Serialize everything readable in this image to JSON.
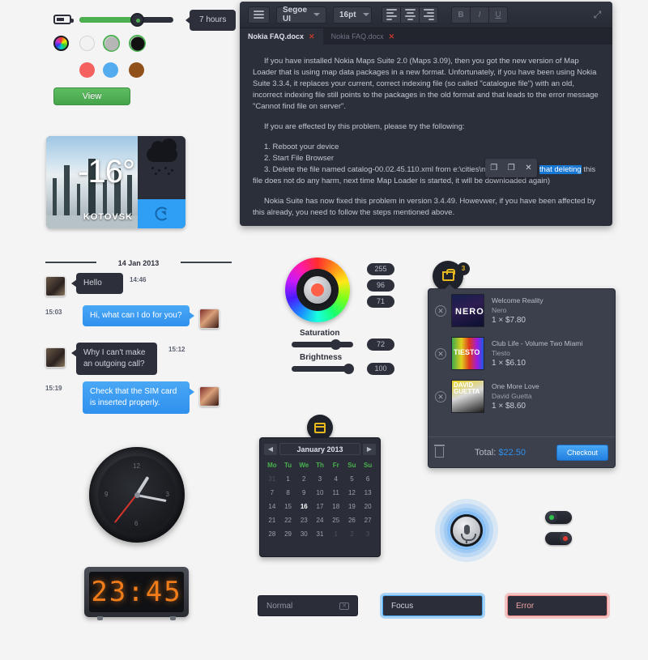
{
  "slider": {
    "tooltip": "7 hours",
    "fill_percent": 58,
    "icon": "battery-icon"
  },
  "swatches": {
    "row1": [
      {
        "name": "rainbow",
        "color": "rainbow",
        "selected": false
      },
      {
        "name": "white",
        "color": "#f2f2f2",
        "selected": false
      },
      {
        "name": "gray",
        "color": "#b6b6b6",
        "selected": true
      },
      {
        "name": "black",
        "color": "#111111",
        "selected": true
      }
    ],
    "row2": [
      {
        "name": "red",
        "color": "#f4615f"
      },
      {
        "name": "blue",
        "color": "#53abf0"
      },
      {
        "name": "brown",
        "color": "#91511a"
      }
    ]
  },
  "view_button": {
    "label": "View"
  },
  "weather": {
    "temperature": "-16°",
    "city": "KOTOVSK",
    "condition_icon": "snow-cloud-icon",
    "refresh_icon": "refresh-icon"
  },
  "chat": {
    "date": "14 Jan 2013",
    "messages": [
      {
        "side": "left",
        "text": "Hello",
        "time": "14:46"
      },
      {
        "side": "right",
        "text": "Hi, what can I do for you?",
        "time": "15:03"
      },
      {
        "side": "left",
        "text": "Why I can't make an outgoing call?",
        "time": "15:12"
      },
      {
        "side": "right",
        "text": "Check that the SIM card is inserted properly.",
        "time": "15:19"
      }
    ]
  },
  "analog_clock": {
    "numerals": [
      "12",
      "3",
      "6",
      "9"
    ]
  },
  "digital_clock": {
    "time": "23:45"
  },
  "editor": {
    "font_family": "Segoe UI",
    "font_size": "16pt",
    "bold_label": "B",
    "italic_label": "I",
    "underline_label": "U",
    "menu_icon": "hamburger-menu-icon",
    "resize_icon": "resize-icon",
    "tabs": [
      {
        "label": "Nokia FAQ.docx",
        "active": true,
        "close": "✕"
      },
      {
        "label": "Nokia FAQ.docx",
        "active": false,
        "close": "✕"
      }
    ],
    "paragraphs": {
      "p1": "If you have installed Nokia Maps Suite 2.0 (Maps 3.09), then you got the new version of Map Loader that is using map data packages in a new format. Unfortunately, if you have been using Nokia Suite 3.3.4, it replaces your current, correct indexing file (so called \"catalogue file\")  with an old, incorrect indexing file still points to the packages in the old format and that leads to the error message \"Cannot find file on server\".",
      "p2": "If you are effected by this problem, please try the following:",
      "step1": "1. Reboot your device",
      "step2": "2. Start File Browser",
      "step3_pre": "3. Delete the file named catalog-00.02.45.110.xml from e:\\cities\\maploader (note ",
      "step3_highlight": "that deleting",
      "step3_post": " this file does not do any harm, next time Map Loader is started, it will be downloaded again)",
      "p4": "Nokia Suite has now fixed this problem in version 3.4.49. Howevwer, if you have been affected by this already, you need to follow the steps mentioned above."
    },
    "float_toolbar": {
      "copy": "copy-icon",
      "paste": "paste-icon",
      "cut": "✕"
    }
  },
  "color_picker": {
    "values": [
      "255",
      "96",
      "71"
    ],
    "saturation": {
      "label": "Saturation",
      "value": "72"
    },
    "brightness": {
      "label": "Brightness",
      "value": "100"
    },
    "selected_color": "#ff6047"
  },
  "calendar": {
    "title": "January 2013",
    "prev": "◀",
    "next": "▶",
    "badge_icon": "calendar-icon",
    "day_names": [
      "Mo",
      "Tu",
      "We",
      "Th",
      "Fr",
      "Su",
      "Su"
    ],
    "weeks": [
      [
        {
          "d": "31",
          "m": true
        },
        {
          "d": "1"
        },
        {
          "d": "2"
        },
        {
          "d": "3"
        },
        {
          "d": "4"
        },
        {
          "d": "5"
        },
        {
          "d": "6"
        }
      ],
      [
        {
          "d": "7"
        },
        {
          "d": "8"
        },
        {
          "d": "9"
        },
        {
          "d": "10"
        },
        {
          "d": "11"
        },
        {
          "d": "12"
        },
        {
          "d": "13"
        }
      ],
      [
        {
          "d": "14"
        },
        {
          "d": "15"
        },
        {
          "d": "16",
          "today": true
        },
        {
          "d": "17"
        },
        {
          "d": "18"
        },
        {
          "d": "19"
        },
        {
          "d": "20"
        }
      ],
      [
        {
          "d": "21"
        },
        {
          "d": "22"
        },
        {
          "d": "23"
        },
        {
          "d": "24"
        },
        {
          "d": "25"
        },
        {
          "d": "26"
        },
        {
          "d": "27"
        }
      ],
      [
        {
          "d": "28"
        },
        {
          "d": "29"
        },
        {
          "d": "30"
        },
        {
          "d": "31"
        },
        {
          "d": "1",
          "m": true
        },
        {
          "d": "2",
          "m": true
        },
        {
          "d": "3",
          "m": true
        }
      ]
    ]
  },
  "cart": {
    "count": "3",
    "cart_icon": "shopping-basket-icon",
    "items": [
      {
        "title": "Welcome Reality",
        "artist": "Nero",
        "price": "1 × $7.80",
        "art": "nero"
      },
      {
        "title": "Club Life - Volume Two Miami",
        "artist": "Tiesto",
        "price": "1 × $6.10",
        "art": "tiesto"
      },
      {
        "title": "One More Love",
        "artist": "David Guetta",
        "price": "1 × $8.60",
        "art": "guetta"
      }
    ],
    "total_label": "Total: ",
    "total_value": "$22.50",
    "checkout_label": "Checkout",
    "trash_icon": "trash-icon",
    "remove_icon": "remove-icon"
  },
  "mic": {
    "icon": "microphone-icon"
  },
  "toggles": [
    {
      "name": "toggle-on",
      "state": "on",
      "dot_color": "#2fbf4a"
    },
    {
      "name": "toggle-off",
      "state": "off",
      "dot_color": "#e03b33"
    }
  ],
  "fields": {
    "normal": {
      "value": "Normal",
      "clear_icon": "clear-icon"
    },
    "focus": {
      "value": "Focus"
    },
    "error": {
      "value": "Error"
    }
  }
}
